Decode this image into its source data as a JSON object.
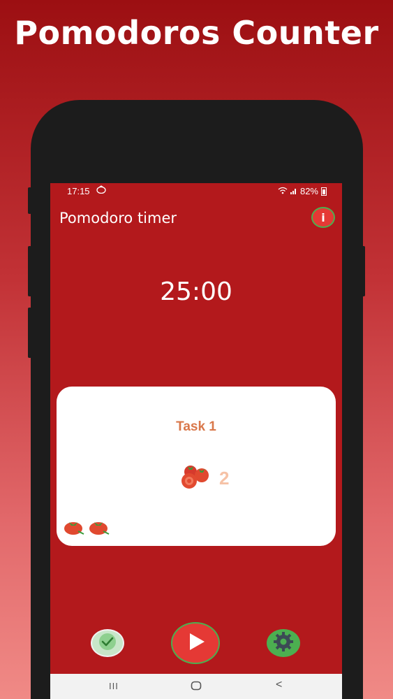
{
  "promo": {
    "title": "Pomodoros Counter"
  },
  "status_bar": {
    "time": "17:15",
    "battery": "82%"
  },
  "app": {
    "title": "Pomodoro timer",
    "info_label": "i"
  },
  "timer": {
    "display": "25:00"
  },
  "task": {
    "name": "Task 1",
    "count": "2",
    "completed_pomodoros": 2
  },
  "nav": {
    "recents": "III",
    "home": "○",
    "back": "<"
  },
  "colors": {
    "background": "#b3191c",
    "accent_red": "#e53935",
    "accent_green": "#4caf50",
    "task_title": "#d9774a",
    "card": "#ffffff"
  },
  "icons": {
    "info": "info-icon",
    "done": "check-icon",
    "play": "play-icon",
    "settings": "gear-icon",
    "tomato": "tomato-icon"
  }
}
